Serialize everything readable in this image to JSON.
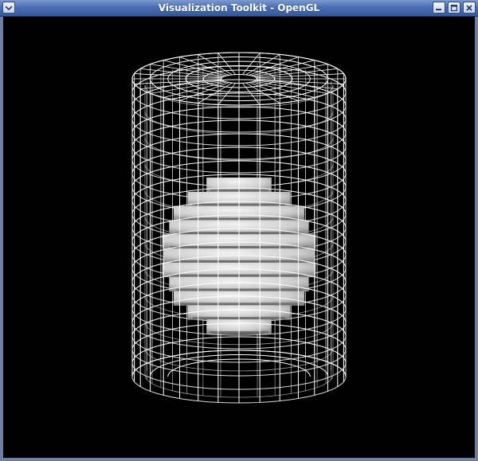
{
  "window": {
    "title": "Visualization Toolkit - OpenGL"
  },
  "titlebar_buttons": [
    {
      "name": "window-menu-button",
      "icon": "chevron-down-icon"
    },
    {
      "name": "minimize-button",
      "icon": "minimize-icon"
    },
    {
      "name": "maximize-button",
      "icon": "maximize-icon"
    },
    {
      "name": "close-button",
      "icon": "close-icon"
    }
  ],
  "scene": {
    "background": "#000000",
    "wireframe_color": "#ffffff",
    "sphere_color": "#cfcfcf",
    "objects": [
      "wireframe-cylinder",
      "shaded-sphere"
    ]
  }
}
